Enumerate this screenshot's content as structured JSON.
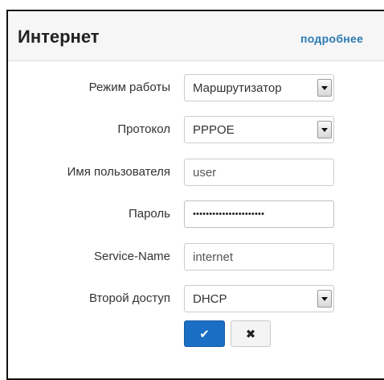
{
  "panel": {
    "title": "Интернет",
    "more_link": "подробнее"
  },
  "form": {
    "mode": {
      "label": "Режим работы",
      "value": "Маршрутизатор"
    },
    "protocol": {
      "label": "Протокол",
      "value": "PPPOE"
    },
    "username": {
      "label": "Имя пользователя",
      "value": "user"
    },
    "password": {
      "label": "Пароль",
      "value": "••••••••••••••••••••••"
    },
    "service_name": {
      "label": "Service-Name",
      "value": "internet"
    },
    "secondary_access": {
      "label": "Второй доступ",
      "value": "DHCP"
    }
  },
  "buttons": {
    "ok_glyph": "✔",
    "cancel_glyph": "✖",
    "ok_icon": "checkmark-icon",
    "cancel_icon": "close-icon"
  },
  "colors": {
    "accent": "#1a6fc4",
    "link": "#2a7ab3"
  }
}
